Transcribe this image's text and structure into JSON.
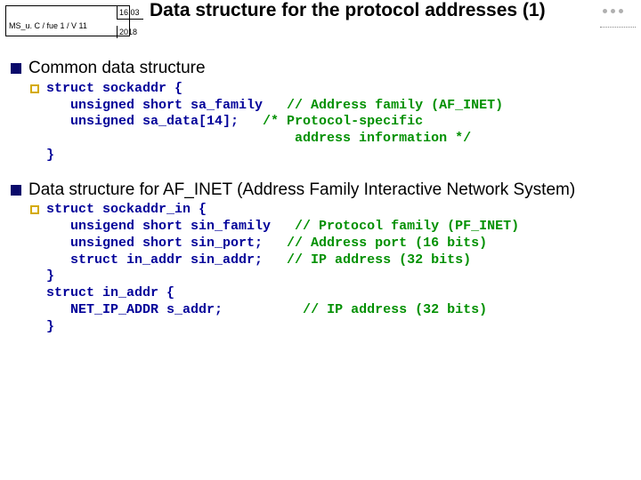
{
  "header": {
    "course_label": "MS_u. C / fue 1 / V 11",
    "date_top": "16.03",
    "date_bot": "2018",
    "title": "Data structure for the protocol addresses (1)"
  },
  "section1": {
    "heading": "Common data structure",
    "code_l1": "struct sockaddr {",
    "code_l2": "   unsigned short sa_family",
    "code_l2_cmt": "   // Address family (AF_INET)",
    "code_l3": "   unsigned sa_data[14];",
    "code_l3_cmt": "   /* Protocol-specific",
    "code_l4_cmt": "                               address information */",
    "code_l5": "}"
  },
  "section2": {
    "heading": "Data structure for AF_INET (Address Family Interactive Network System)",
    "code_l1": "struct sockaddr_in {",
    "code_l2": "   unsigend short sin_family",
    "code_l2_cmt": "   // Protocol family (PF_INET)",
    "code_l3": "   unsigned short sin_port;",
    "code_l3_cmt": "   // Address port (16 bits)",
    "code_l4": "   struct in_addr sin_addr;",
    "code_l4_cmt": "   // IP address (32 bits)",
    "code_l5": "}",
    "code_l6": "struct in_addr {",
    "code_l7": "   NET_IP_ADDR s_addr;",
    "code_l7_cmt": "          // IP address (32 bits)",
    "code_l8": "}"
  }
}
